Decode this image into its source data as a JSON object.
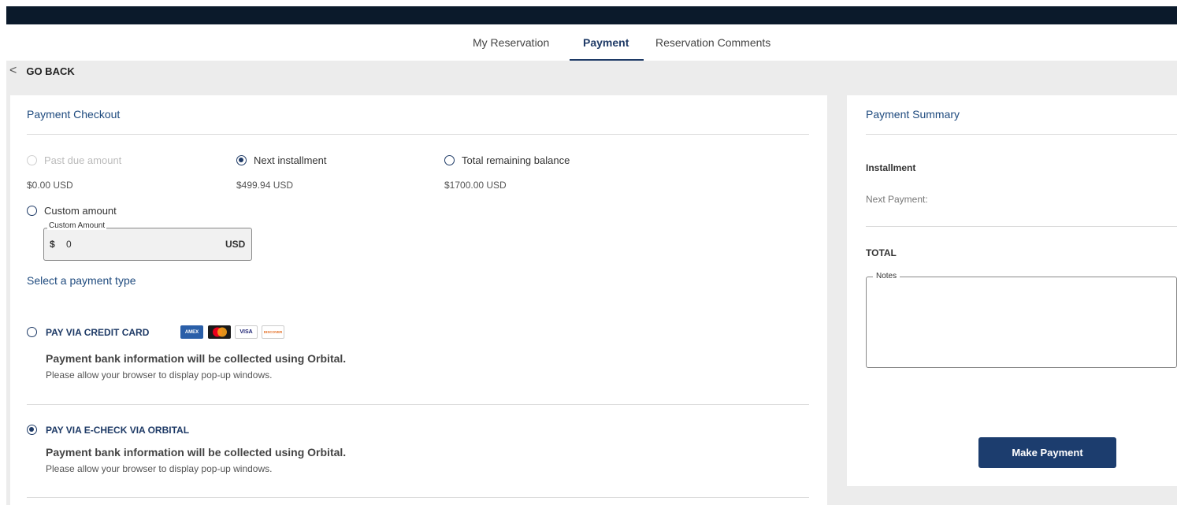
{
  "tabs": [
    {
      "label": "My Reservation"
    },
    {
      "label": "Payment"
    },
    {
      "label": "Reservation Comments"
    }
  ],
  "go_back": "GO BACK",
  "checkout": {
    "title": "Payment Checkout",
    "options": [
      {
        "label": "Past due amount",
        "amount": "$0.00 USD",
        "state": "disabled"
      },
      {
        "label": "Next installment",
        "amount": "$499.94 USD",
        "state": "checked"
      },
      {
        "label": "Total remaining balance",
        "amount": "$1700.00 USD",
        "state": "unchecked"
      }
    ],
    "custom": {
      "label": "Custom amount",
      "legend": "Custom Amount",
      "prefix": "$",
      "value": "0",
      "suffix": "USD"
    },
    "payment_type_title": "Select a payment type",
    "credit_card": {
      "title": "PAY VIA CREDIT CARD",
      "bold": "Payment bank information will be collected using Orbital.",
      "note": "Please allow your browser to display pop-up windows.",
      "logos": [
        "AMEX",
        "",
        "VISA",
        "DISCOVER"
      ]
    },
    "echeck": {
      "title": "PAY VIA E-CHECK VIA ORBITAL",
      "bold": "Payment bank information will be collected using Orbital.",
      "note": "Please allow your browser to display pop-up windows."
    }
  },
  "summary": {
    "title": "Payment Summary",
    "installment": "Installment",
    "next_payment": "Next Payment:",
    "total": "TOTAL",
    "notes_legend": "Notes",
    "button": "Make Payment"
  },
  "colors": {
    "accent": "#1e3a66",
    "topbar": "#0b1a2b",
    "button": "#1c3d6e"
  }
}
